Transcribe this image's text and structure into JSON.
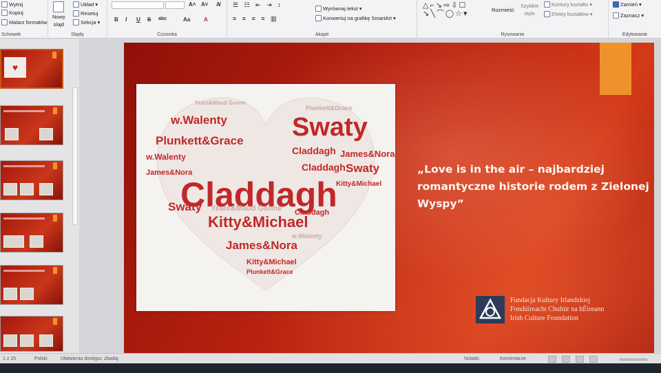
{
  "ribbon": {
    "clipboard": {
      "cut": "Wytnij",
      "copy": "Kopiuj",
      "format_painter": "Malarz formatów",
      "group": "Schowek"
    },
    "slides": {
      "new_slide_line1": "Nowy",
      "new_slide_line2": "slajd",
      "layout": "Układ",
      "reset": "Resetuj",
      "section": "Sekcja",
      "group": "Slajdy"
    },
    "font": {
      "bold": "B",
      "italic": "I",
      "underline": "U",
      "strike": "S",
      "spacing": "abc",
      "case": "Aa",
      "group": "Czcionka"
    },
    "paragraph": {
      "align_text": "Wyrównaj tekst",
      "smartart": "Konwertuj na grafikę SmartArt",
      "group": "Akapit"
    },
    "drawing": {
      "arrange_line1": "Rozmieść",
      "quick_styles_line1": "Szybkie",
      "quick_styles_line2": "style",
      "shape_outline": "Kontury kształtu",
      "shape_effects": "Efekty kształtów",
      "group": "Rysowanie"
    },
    "editing": {
      "replace": "Zamień",
      "select": "Zaznacz",
      "group": "Edytowanie"
    }
  },
  "slide": {
    "quote": "„Love is in the air – najbardziej romantyczne historie rodem z Zielonej Wyspy”",
    "logo_lines": [
      "Fundacja Kultury Irlandzkiej",
      "Fondúireacht Chultúr na hÉireann",
      "Irish Culture Foundation"
    ],
    "wordcloud": {
      "big": "Claddagh",
      "swaty": "Swaty",
      "plunkett": "Plunkett&Grace",
      "kitty": "Kitty&Michael",
      "walenty": "w.Walenty",
      "james": "James&Nora",
      "yeats": "Yeats&Maud Gonne"
    },
    "colors": {
      "accent_orange": "#f0922c",
      "word_red": "#c0282a",
      "logo_blue": "#2c3b57"
    }
  },
  "statusbar": {
    "slide_counter": "1 z 15",
    "language": "Polski",
    "accessibility": "Ułatwienia dostępu: zbadaj",
    "notes": "Notatki",
    "comments": "Komentarze"
  }
}
